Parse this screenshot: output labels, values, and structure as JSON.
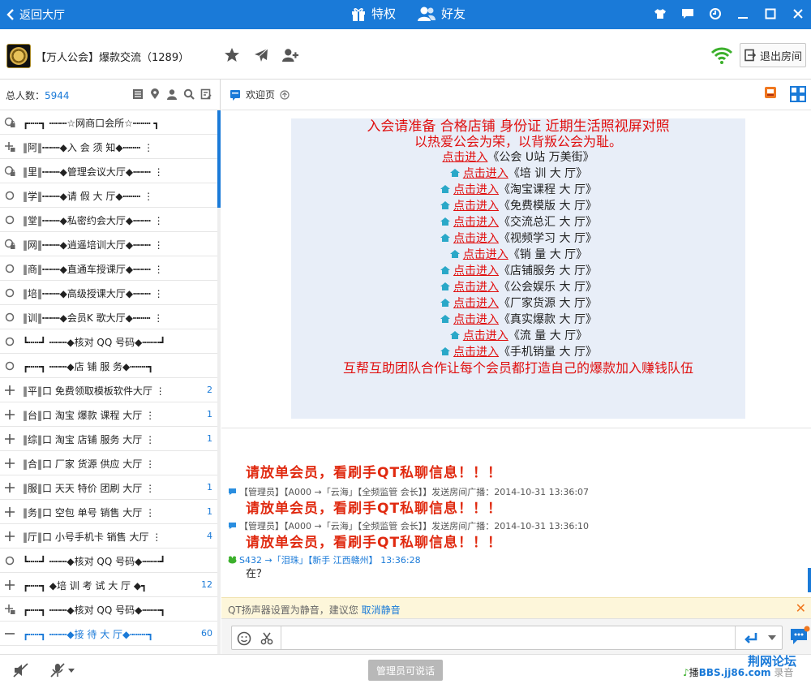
{
  "topbar": {
    "back_label": "返回大厅",
    "privilege_label": "特权",
    "friends_label": "好友"
  },
  "room": {
    "name": "【万人公会】爆款交流（1289）",
    "exit_label": "退出房间"
  },
  "left": {
    "total_label": "总人数：",
    "total_value": "5944",
    "channels": [
      {
        "icon": "lock",
        "name": "┏┅┅┓ ┅┅┅☆网商口会所☆┅┅┅ ┓",
        "num": ""
      },
      {
        "icon": "plus-lock",
        "name": "‖阿‖┅┅┅◆入 会  须 知◆┅┅┅ ⋮",
        "num": ""
      },
      {
        "icon": "lock",
        "name": "‖里‖┅┅┅◆管理会议大厅◆┅┅┅ ⋮",
        "num": ""
      },
      {
        "icon": "circle",
        "name": "‖学‖┅┅┅◆请 假  大 厅◆┅┅┅ ⋮",
        "num": ""
      },
      {
        "icon": "circle",
        "name": "‖堂‖┅┅┅◆私密约会大厅◆┅┅┅ ⋮",
        "num": ""
      },
      {
        "icon": "lock",
        "name": "‖网‖┅┅┅◆逍遥培训大厅◆┅┅┅ ⋮",
        "num": ""
      },
      {
        "icon": "circle",
        "name": "‖商‖┅┅┅◆直通车授课厅◆┅┅┅ ⋮",
        "num": ""
      },
      {
        "icon": "circle",
        "name": "‖培‖┅┅┅◆高级授课大厅◆┅┅┅ ⋮",
        "num": ""
      },
      {
        "icon": "circle",
        "name": "‖训‖┅┅┅◆会员K 歌大厅◆┅┅┅ ⋮",
        "num": ""
      },
      {
        "icon": "circle",
        "name": "┗┅┅┛ ┅┅┅◆核对 QQ 号码◆┅┅┅┛",
        "num": ""
      },
      {
        "icon": "circle",
        "name": "┏┅┅┓ ┅┅┅◆店 铺  服 务◆┅┅┅┓",
        "num": ""
      },
      {
        "icon": "plus",
        "name": "‖平‖口 免费领取模板软件大厅 ⋮",
        "num": "2"
      },
      {
        "icon": "plus",
        "name": "‖台‖口 淘宝 爆款  课程 大厅 ⋮",
        "num": "1"
      },
      {
        "icon": "plus",
        "name": "‖综‖口 淘宝 店铺  服务 大厅 ⋮",
        "num": "1"
      },
      {
        "icon": "plus",
        "name": "‖合‖口 厂家 货源  供应 大厅 ⋮",
        "num": ""
      },
      {
        "icon": "plus",
        "name": "‖服‖口 天天 特价  团刷 大厅 ⋮",
        "num": "1"
      },
      {
        "icon": "plus",
        "name": "‖务‖口 空包 单号  销售 大厅 ⋮",
        "num": "1"
      },
      {
        "icon": "plus",
        "name": "‖厅‖口 小号手机卡 销售 大厅 ⋮",
        "num": "4"
      },
      {
        "icon": "circle",
        "name": "┗┅┅┛ ┅┅┅◆核对 QQ 号码◆┅┅┅┛",
        "num": ""
      },
      {
        "icon": "plus",
        "name": "┏┅┅┓  ◆培 训 考 试 大 厅 ◆┓",
        "num": "12"
      },
      {
        "icon": "plus-lock",
        "name": "┏┅┅┓ ┅┅┅◆核对 QQ 号码◆┅┅┅┓",
        "num": ""
      },
      {
        "icon": "minus",
        "name": "┏┅┅┓ ┅┅┅◆接  待 大 厅◆┅┅┅┓",
        "num": "60"
      }
    ]
  },
  "tab": {
    "welcome_label": "欢迎页"
  },
  "welcome": {
    "line1": "入会请准备 合格店铺 身份证 近期生活照视屏对照",
    "line2": "以热爱公会为荣，以背叛公会为耻。",
    "link_text": "点击进入",
    "rows": [
      "《公会 U站  万美街》",
      "《培    训 大  厅》",
      "《淘宝课程 大  厅》",
      "《免费模版 大  厅》",
      "《交流总汇 大  厅》",
      "《视频学习 大  厅》",
      "《销    量 大  厅》",
      "《店铺服务 大  厅》",
      "《公会娱乐 大  厅》",
      "《厂家货源 大  厅》",
      "《真实爆款 大  厅》",
      "《流    量 大  厅》",
      "《手机销量 大  厅》"
    ],
    "footer": "互帮互助团队合作让每个会员都打造自己的爆款加入赚钱队伍"
  },
  "chat": {
    "messages": [
      {
        "header": "【管理员】【A000 →「云海」【全频监管 会长】】发送房间广播：2014-10-31 13:36:07",
        "body": "请放单会员，看刷手QT私聊信息！！！"
      },
      {
        "header": "【管理员】【A000 →「云海」【全频监管 会长】】发送房间广播：2014-10-31 13:36:10",
        "body": "请放单会员，看刷手QT私聊信息！！！"
      }
    ],
    "partial_body": "请放单会员，看刷手QT私聊信息！！！",
    "last_user": "S432 →「泪珠」【新手 江西赣州】",
    "last_time": "13:36:28",
    "last_body": "在？"
  },
  "notice": {
    "text": "QT扬声器设置为静音，建议您",
    "action": "取消静音"
  },
  "bottom": {
    "admin_btn": "管理员可说话",
    "watermark_top": "荆网论坛",
    "watermark_left": "播",
    "watermark_site": "BBS.jj86.com",
    "watermark_right": "录音"
  }
}
